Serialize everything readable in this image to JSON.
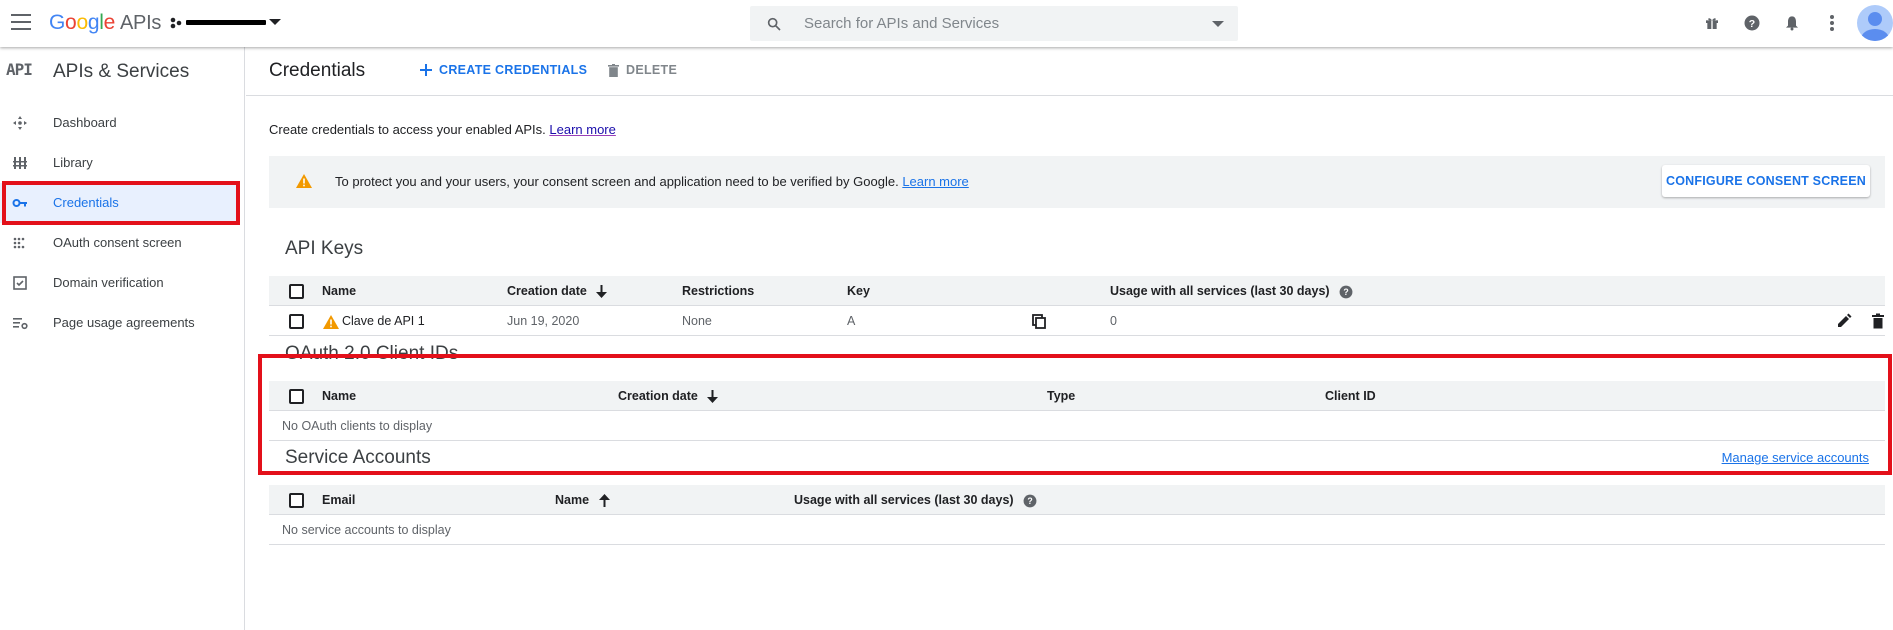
{
  "topbar": {
    "logo": {
      "g": "G",
      "o1": "o",
      "o2": "o",
      "g2": "g",
      "l": "l",
      "e": "e",
      "apis": "APIs"
    },
    "search_placeholder": "Search for APIs and Services",
    "icons": [
      "gift-icon",
      "help-icon",
      "notifications-icon",
      "more-vert-icon"
    ]
  },
  "sidebar": {
    "title": "APIs & Services",
    "api_badge": "API",
    "items": [
      {
        "label": "Dashboard",
        "icon": "dashboard-icon"
      },
      {
        "label": "Library",
        "icon": "library-icon"
      },
      {
        "label": "Credentials",
        "icon": "key-icon",
        "active": true
      },
      {
        "label": "OAuth consent screen",
        "icon": "consent-icon"
      },
      {
        "label": "Domain verification",
        "icon": "checkbox-icon"
      },
      {
        "label": "Page usage agreements",
        "icon": "settings-list-icon"
      }
    ]
  },
  "main": {
    "title": "Credentials",
    "create_label": "CREATE CREDENTIALS",
    "delete_label": "DELETE",
    "intro": "Create credentials to access your enabled APIs.",
    "intro_link": "Learn more",
    "banner": {
      "message": "To protect you and your users, your consent screen and application need to be verified by Google.",
      "link": "Learn more",
      "button": "CONFIGURE CONSENT SCREEN"
    },
    "api_keys": {
      "title": "API Keys",
      "columns": [
        "Name",
        "Creation date",
        "Restrictions",
        "Key",
        "Usage with all services (last 30 days)"
      ],
      "rows": [
        {
          "name": "Clave de API 1",
          "date": "Jun 19, 2020",
          "restrictions": "None",
          "key": "A",
          "usage": "0"
        }
      ]
    },
    "oauth": {
      "title": "OAuth 2.0 Client IDs",
      "columns": [
        "Name",
        "Creation date",
        "Type",
        "Client ID"
      ],
      "empty": "No OAuth clients to display"
    },
    "service_accounts": {
      "title": "Service Accounts",
      "manage_link": "Manage service accounts",
      "columns": [
        "Email",
        "Name",
        "Usage with all services (last 30 days)"
      ],
      "empty": "No service accounts to display"
    }
  },
  "colors": {
    "accent": "#1a73e8",
    "highlight_red": "#e3101a",
    "warning": "#f29900"
  }
}
